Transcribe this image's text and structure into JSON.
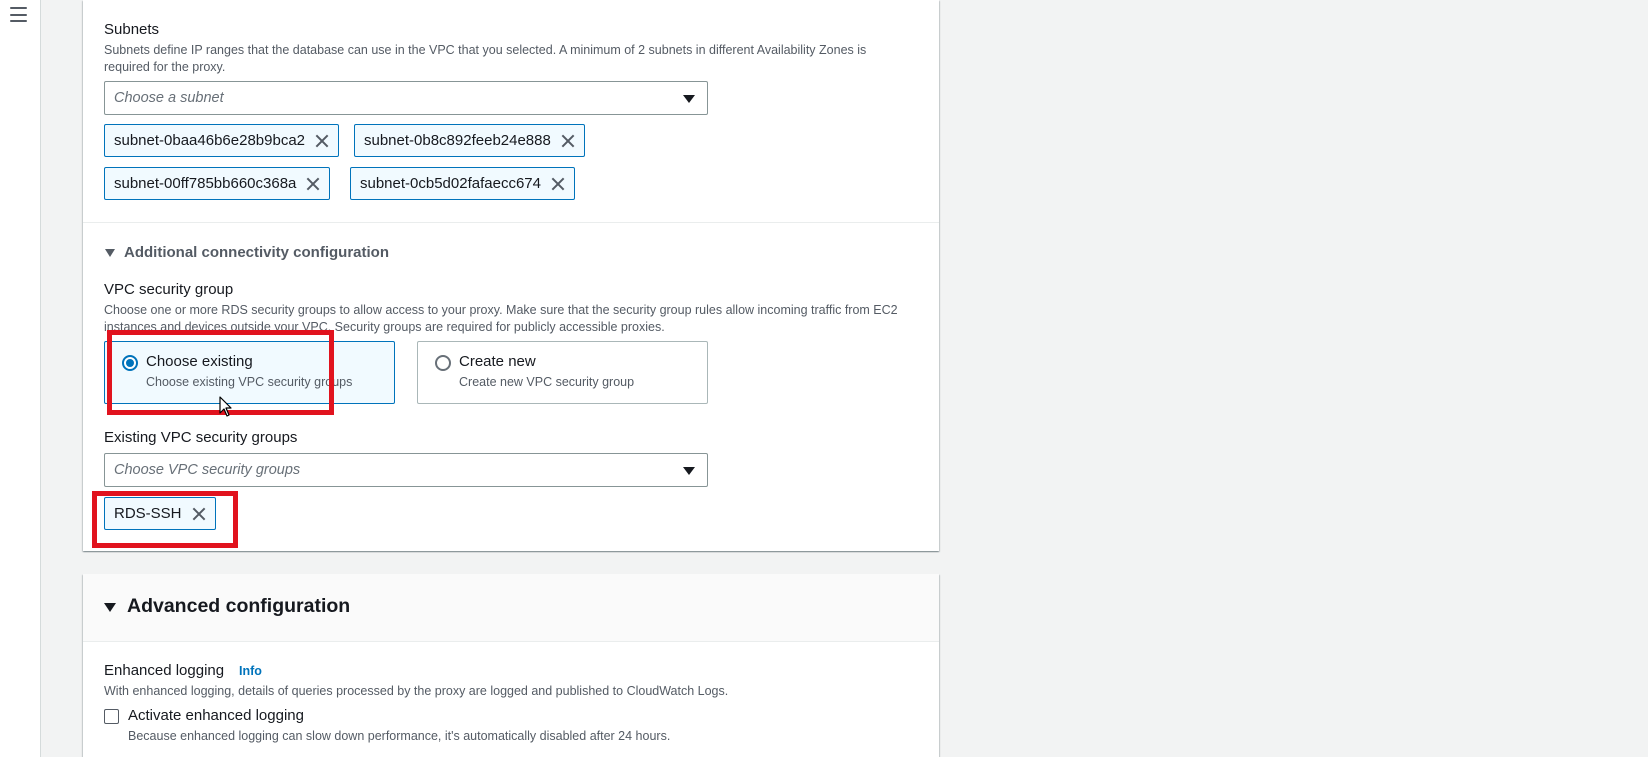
{
  "subnets": {
    "label": "Subnets",
    "description": "Subnets define IP ranges that the database can use in the VPC that you selected. A minimum of 2 subnets in different Availability Zones is required for the proxy.",
    "placeholder": "Choose a subnet",
    "tokens": [
      "subnet-0baa46b6e28b9bca2",
      "subnet-0b8c892feeb24e888",
      "subnet-00ff785bb660c368a",
      "subnet-0cb5d02fafaecc674"
    ]
  },
  "connectivity": {
    "expander_label": "Additional connectivity configuration",
    "vpc_sg_label": "VPC security group",
    "vpc_sg_description": "Choose one or more RDS security groups to allow access to your proxy. Make sure that the security group rules allow incoming traffic from EC2 instances and devices outside your VPC. Security groups are required for publicly accessible proxies.",
    "options": [
      {
        "title": "Choose existing",
        "description": "Choose existing VPC security groups",
        "selected": true
      },
      {
        "title": "Create new",
        "description": "Create new VPC security group",
        "selected": false
      }
    ],
    "existing_label": "Existing VPC security groups",
    "existing_placeholder": "Choose VPC security groups",
    "existing_tokens": [
      "RDS-SSH"
    ]
  },
  "advanced": {
    "title": "Advanced configuration",
    "logging_label": "Enhanced logging",
    "info": "Info",
    "logging_description": "With enhanced logging, details of queries processed by the proxy are logged and published to CloudWatch Logs.",
    "checkbox_label": "Activate enhanced logging",
    "checkbox_checked": false,
    "checkbox_description": "Because enhanced logging can slow down performance, it's automatically disabled after 24 hours."
  },
  "colors": {
    "accent": "#0073bb",
    "highlight": "#e1131e",
    "page_background": "#f2f3f3"
  },
  "icons": {
    "menu": "hamburger-menu-icon",
    "remove": "close-x-icon",
    "dropdown": "caret-down-icon",
    "expand": "triangle-down-icon"
  }
}
